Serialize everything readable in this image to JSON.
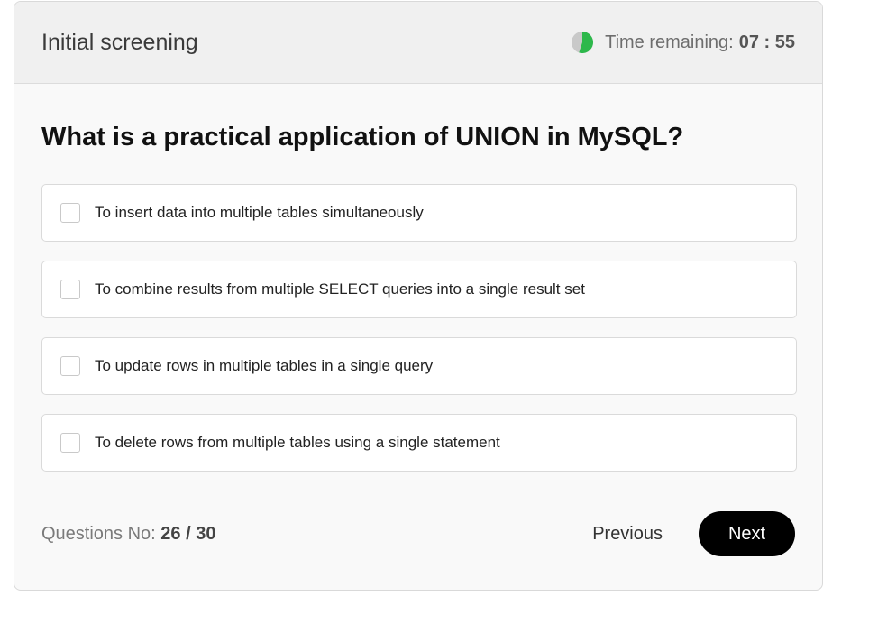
{
  "header": {
    "title": "Initial screening",
    "timer_label": "Time remaining:",
    "timer_value": "07 : 55",
    "timer_icon": "progress-pie-icon",
    "timer_progress": 0.55,
    "timer_color": "#2db84b"
  },
  "question": {
    "text": "What is a practical application of UNION in MySQL?",
    "options": [
      {
        "label": "To insert data into multiple tables simultaneously",
        "checked": false
      },
      {
        "label": "To combine results from multiple SELECT queries into a single result set",
        "checked": false
      },
      {
        "label": "To update rows in multiple tables in a single query",
        "checked": false
      },
      {
        "label": "To delete rows from multiple tables using a single statement",
        "checked": false
      }
    ]
  },
  "footer": {
    "qno_label": "Questions No:",
    "qno_value": "26 / 30",
    "previous_label": "Previous",
    "next_label": "Next"
  }
}
